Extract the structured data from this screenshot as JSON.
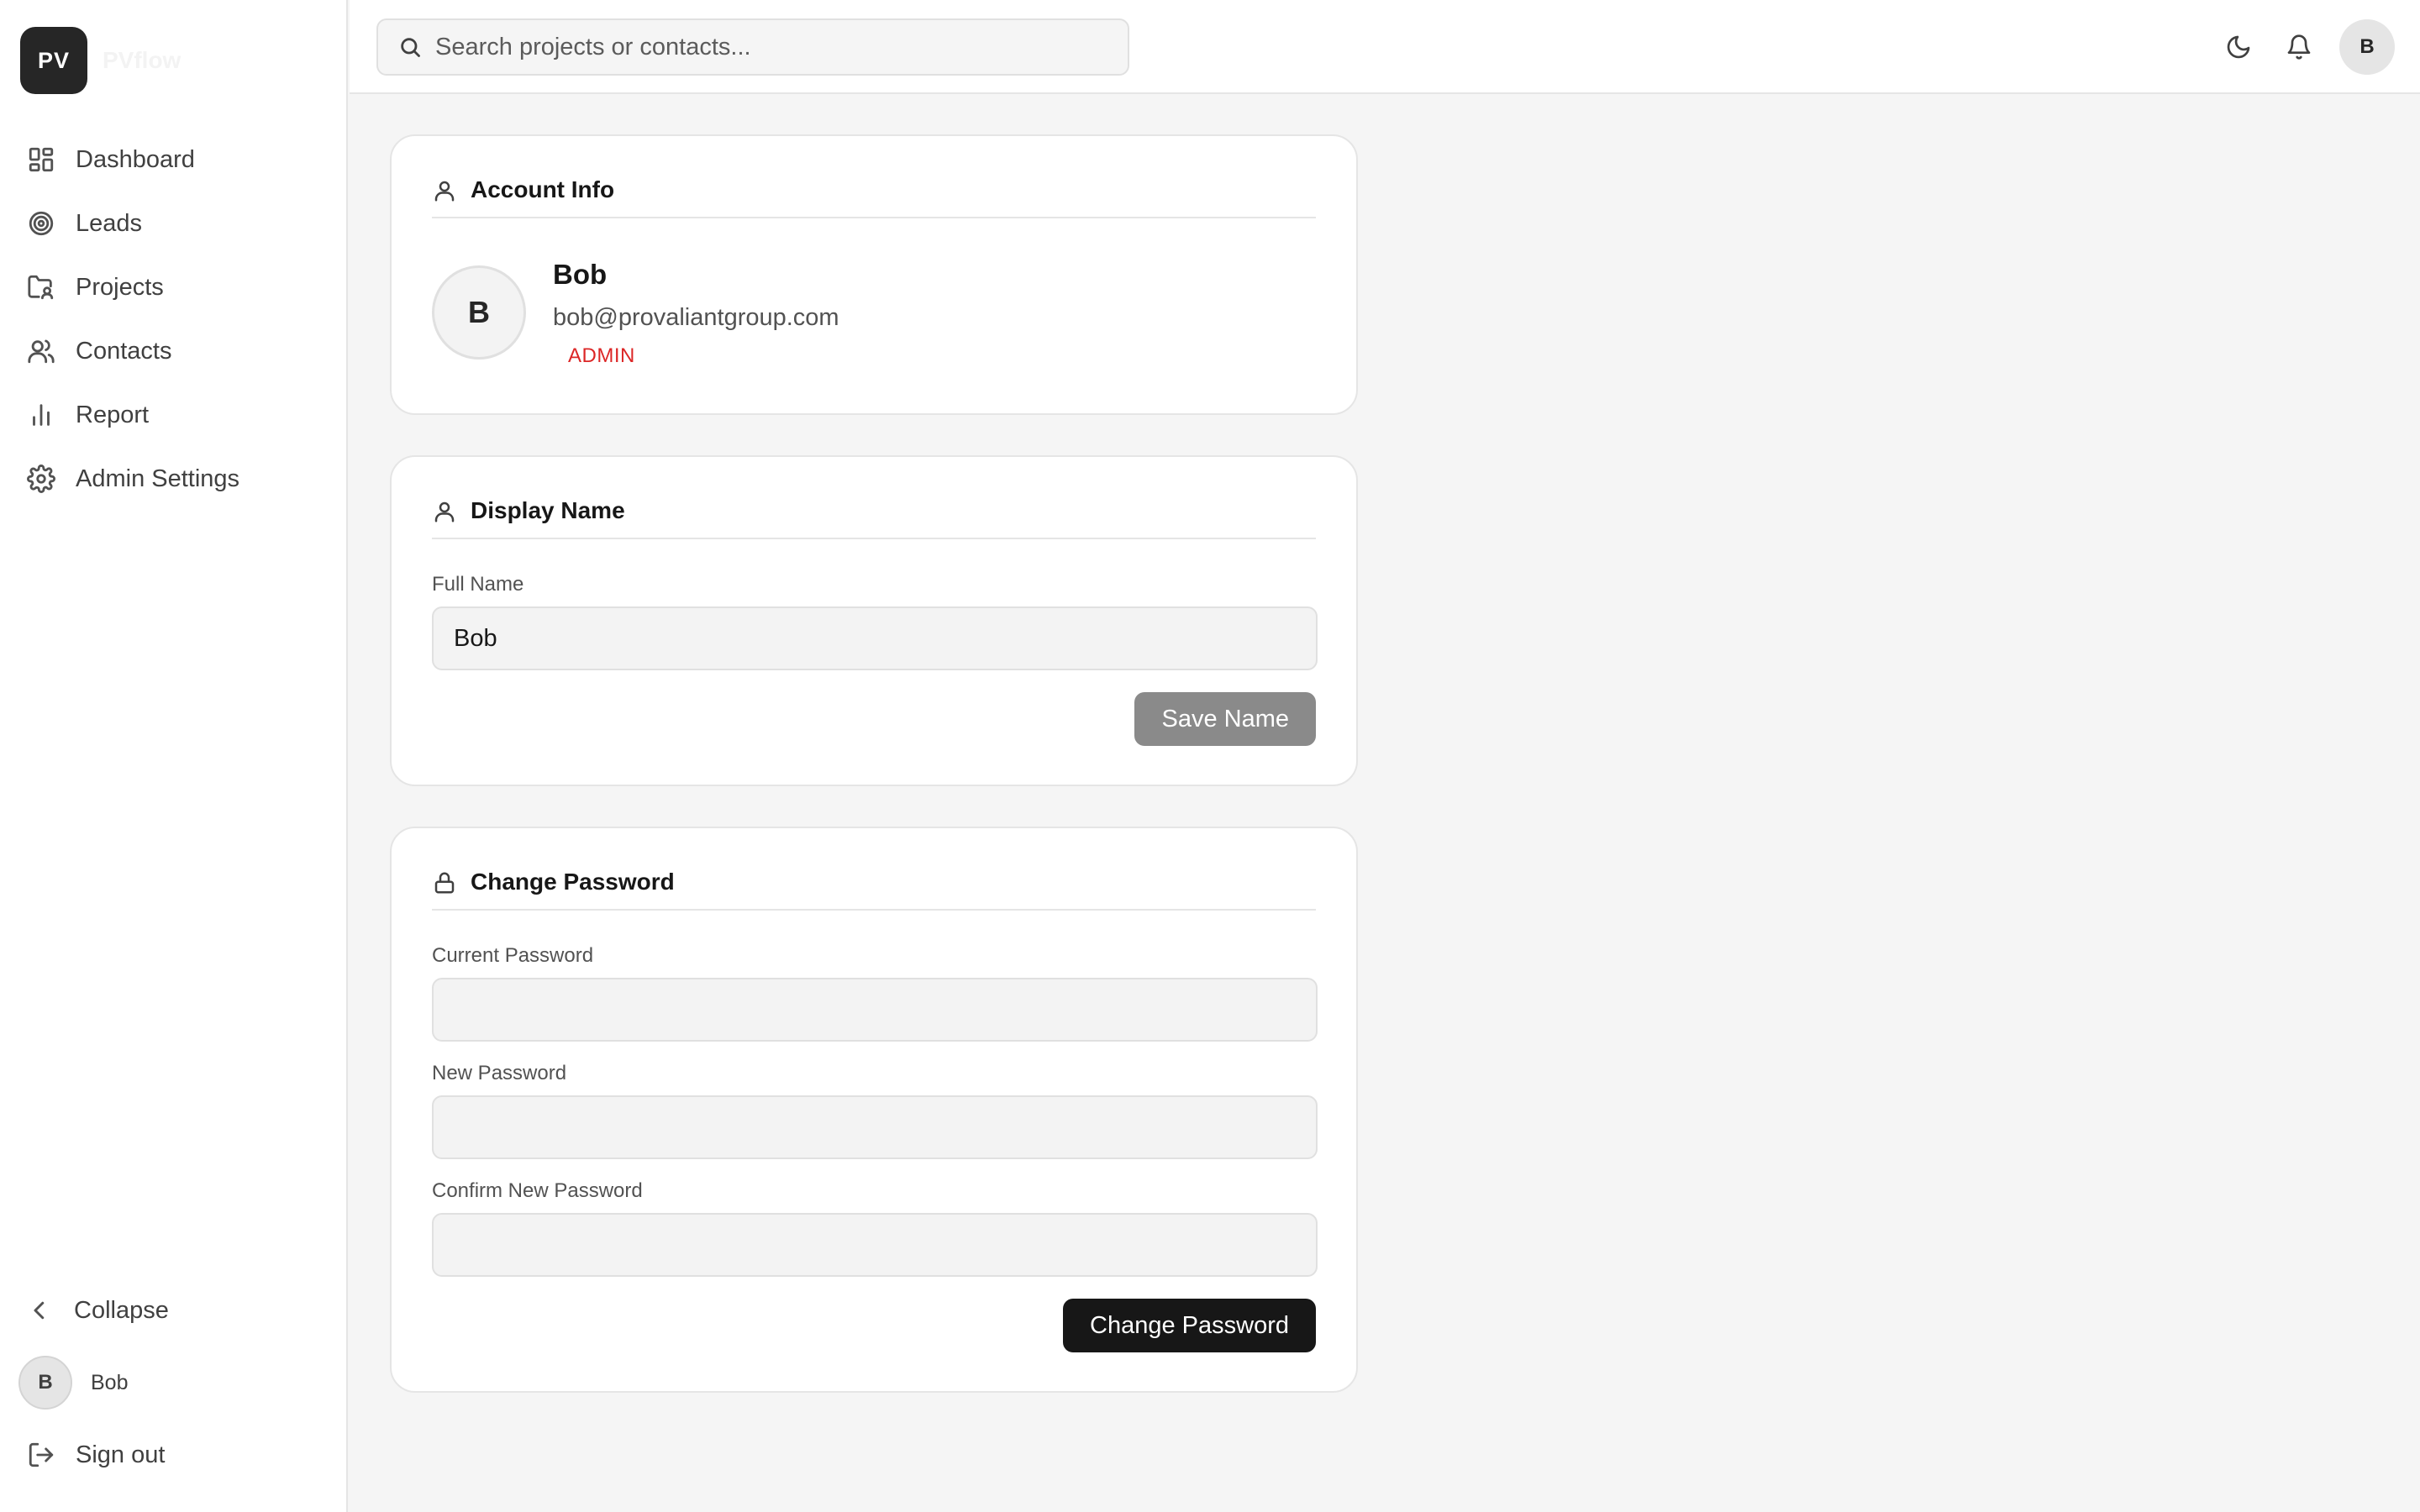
{
  "brand": {
    "initials": "PV",
    "name": "PVflow"
  },
  "sidebar": {
    "items": [
      {
        "label": "Dashboard",
        "icon": "dashboard-icon"
      },
      {
        "label": "Leads",
        "icon": "target-icon"
      },
      {
        "label": "Projects",
        "icon": "folder-user-icon"
      },
      {
        "label": "Contacts",
        "icon": "users-icon"
      },
      {
        "label": "Report",
        "icon": "bar-chart-icon"
      },
      {
        "label": "Admin Settings",
        "icon": "gear-icon"
      }
    ],
    "collapse_label": "Collapse",
    "user": {
      "initial": "B",
      "name": "Bob"
    },
    "signout_label": "Sign out"
  },
  "topbar": {
    "search_placeholder": "Search projects or contacts...",
    "avatar_initial": "B"
  },
  "account": {
    "title": "Account Info",
    "avatar_initial": "B",
    "name": "Bob",
    "email": "bob@provaliantgroup.com",
    "role": "ADMIN"
  },
  "display_name": {
    "title": "Display Name",
    "field_label": "Full Name",
    "field_value": "Bob",
    "save_label": "Save Name"
  },
  "password": {
    "title": "Change Password",
    "current_label": "Current Password",
    "new_label": "New Password",
    "confirm_label": "Confirm New Password",
    "submit_label": "Change Password"
  },
  "colors": {
    "accent_dark": "#171717",
    "role_red": "#dc2626",
    "muted_button": "#8a8a8a"
  }
}
